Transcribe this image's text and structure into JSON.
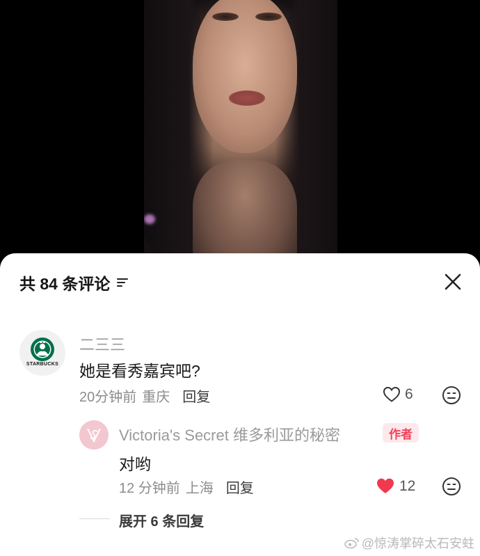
{
  "comments_header": {
    "title": "共 84 条评论"
  },
  "comment": {
    "nickname": "二三三",
    "avatar_brand": "STARBUCKS",
    "text": "她是看秀嘉宾吧?",
    "time": "20分钟前",
    "location": "重庆",
    "reply_label": "回复",
    "likes": "6",
    "liked": false
  },
  "reply": {
    "nickname": "Victoria's Secret 维多利亚的秘密",
    "badge": "作者",
    "text": "对哟",
    "time": "12 分钟前",
    "location": "上海",
    "reply_label": "回复",
    "likes": "12",
    "liked": true
  },
  "expand": {
    "label": "展开 6 条回复"
  },
  "watermark": {
    "text": "@惊涛掌碎太石安蛀"
  },
  "colors": {
    "like_active": "#f0384f",
    "author_badge_bg": "#fde9ec",
    "author_badge_text": "#f0425b",
    "starbucks_green": "#00704a"
  },
  "icons": [
    "filter-icon",
    "close-icon",
    "heart-outline-icon",
    "heart-filled-icon",
    "emoji-icon",
    "weibo-icon"
  ]
}
